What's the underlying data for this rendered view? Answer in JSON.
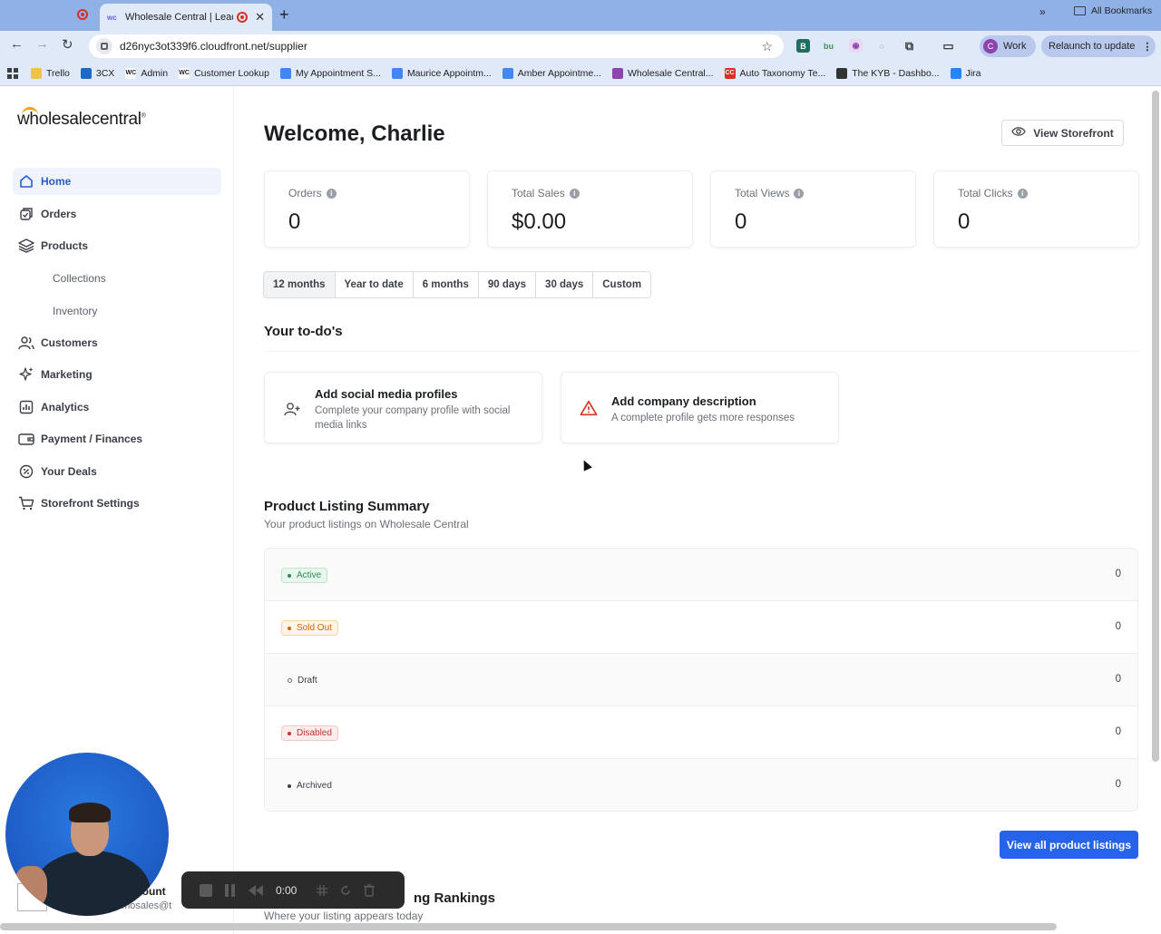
{
  "browser": {
    "active_tab_title": "Wholesale Central | Leadi",
    "tab_favicon_text": "wc",
    "url": "d26nyc3ot339f6.cloudfront.net/supplier",
    "profile_label": "Work",
    "profile_initial": "C",
    "relaunch_label": "Relaunch to update",
    "bookmarks": [
      {
        "label": "Trello",
        "icon": "trello-icon",
        "color": "#f0c24a"
      },
      {
        "label": "3CX",
        "icon": "3cx-icon",
        "color": "#1b6ac9"
      },
      {
        "label": "Admin",
        "icon": "wc-icon",
        "color": "#ffffff"
      },
      {
        "label": "Customer Lookup",
        "icon": "wc-icon",
        "color": "#ffffff"
      },
      {
        "label": "My Appointment S...",
        "icon": "calendar-icon",
        "color": "#4285f4"
      },
      {
        "label": "Maurice Appointm...",
        "icon": "calendar-icon",
        "color": "#4285f4"
      },
      {
        "label": "Amber Appointme...",
        "icon": "calendar-icon",
        "color": "#4285f4"
      },
      {
        "label": "Wholesale Central...",
        "icon": "wholesale-icon",
        "color": "#8e44ad"
      },
      {
        "label": "Auto Taxonomy Te...",
        "icon": "cc-icon",
        "color": "#d93025"
      },
      {
        "label": "The KYB - Dashbo...",
        "icon": "kyb-icon",
        "color": "#333333"
      },
      {
        "label": "Jira",
        "icon": "jira-icon",
        "color": "#2684ff"
      }
    ],
    "all_bookmarks_label": "All Bookmarks",
    "more_label": "»"
  },
  "sidebar": {
    "logo_text": "wholesalecentral",
    "logo_mark": "®",
    "items": [
      {
        "label": "Home",
        "icon": "home-icon",
        "active": true
      },
      {
        "label": "Orders",
        "icon": "orders-icon"
      },
      {
        "label": "Products",
        "icon": "layers-icon"
      },
      {
        "label": "Collections",
        "sub": true
      },
      {
        "label": "Inventory",
        "sub": true
      },
      {
        "label": "Customers",
        "icon": "users-icon"
      },
      {
        "label": "Marketing",
        "icon": "sparkles-icon"
      },
      {
        "label": "Analytics",
        "icon": "chart-icon"
      },
      {
        "label": "Payment / Finances",
        "icon": "wallet-icon"
      },
      {
        "label": "Your Deals",
        "icon": "percent-icon"
      },
      {
        "label": "Storefront Settings",
        "icon": "cart-icon"
      }
    ],
    "account_label": "count",
    "account_email": "emosales@t"
  },
  "header": {
    "welcome": "Welcome, Charlie",
    "view_storefront": "View Storefront"
  },
  "stats": [
    {
      "label": "Orders",
      "value": "0"
    },
    {
      "label": "Total Sales",
      "value": "$0.00"
    },
    {
      "label": "Total Views",
      "value": "0"
    },
    {
      "label": "Total Clicks",
      "value": "0"
    }
  ],
  "ranges": [
    "12 months",
    "Year to date",
    "6 months",
    "90 days",
    "30 days",
    "Custom"
  ],
  "active_range": "12 months",
  "todos": {
    "title": "Your to-do's",
    "items": [
      {
        "title": "Add social media profiles",
        "desc": "Complete your company profile with social media links",
        "icon": "add-user-icon"
      },
      {
        "title": "Add company description",
        "desc": "A complete profile gets more responses",
        "icon": "warning-icon"
      }
    ]
  },
  "listing_summary": {
    "title": "Product Listing Summary",
    "subtitle": "Your product listings on Wholesale Central",
    "rows": [
      {
        "status": "Active",
        "count": "0",
        "bg": "#e8f7ee",
        "fg": "#2f8a4f",
        "border": "#bfe6cd"
      },
      {
        "status": "Sold Out",
        "count": "0",
        "bg": "#fff4e5",
        "fg": "#c26a10",
        "border": "#f6d3a3"
      },
      {
        "status": "Draft",
        "count": "0",
        "bg": "transparent",
        "fg": "#3a3f47",
        "border": "transparent"
      },
      {
        "status": "Disabled",
        "count": "0",
        "bg": "#fdecec",
        "fg": "#c53030",
        "border": "#f5c6c6"
      },
      {
        "status": "Archived",
        "count": "0",
        "bg": "transparent",
        "fg": "#3a3f47",
        "border": "transparent"
      }
    ],
    "view_all": "View all product listings"
  },
  "rankings": {
    "title": "ng Rankings",
    "subtitle": "Where your listing appears today"
  },
  "recorder": {
    "time": "0:00"
  },
  "colors": {
    "accent": "#2563eb",
    "tabbar": "#8fb1e6",
    "toolbar": "#dfe9f8"
  }
}
